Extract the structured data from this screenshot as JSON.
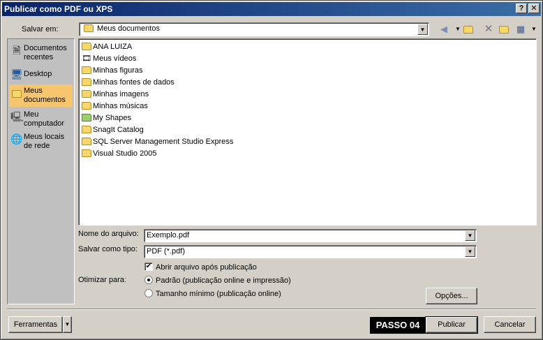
{
  "window": {
    "title": "Publicar como PDF ou XPS",
    "help_button": "?",
    "close_button": "✕"
  },
  "savein": {
    "label": "Salvar em:",
    "value": "Meus documentos"
  },
  "toolbar": {
    "icons": [
      "back-icon",
      "up-folder-icon",
      "delete-icon",
      "new-folder-icon",
      "views-icon"
    ]
  },
  "places": [
    {
      "label": "Documentos recentes",
      "icon": "recent-documents-icon"
    },
    {
      "label": "Desktop",
      "icon": "desktop-icon"
    },
    {
      "label": "Meus documentos",
      "icon": "my-documents-icon",
      "selected": true
    },
    {
      "label": "Meu computador",
      "icon": "my-computer-icon"
    },
    {
      "label": "Meus locais de rede",
      "icon": "network-places-icon"
    }
  ],
  "files": [
    {
      "name": "ANA LUIZA",
      "icon": "folder-icon"
    },
    {
      "name": "Meus vídeos",
      "icon": "videos-folder-icon"
    },
    {
      "name": "Minhas figuras",
      "icon": "pictures-folder-icon"
    },
    {
      "name": "Minhas fontes de dados",
      "icon": "data-sources-folder-icon"
    },
    {
      "name": "Minhas imagens",
      "icon": "images-folder-icon"
    },
    {
      "name": "Minhas músicas",
      "icon": "music-folder-icon"
    },
    {
      "name": "My Shapes",
      "icon": "shapes-folder-icon"
    },
    {
      "name": "SnagIt Catalog",
      "icon": "folder-icon"
    },
    {
      "name": "SQL Server Management Studio Express",
      "icon": "folder-icon"
    },
    {
      "name": "Visual Studio 2005",
      "icon": "folder-icon"
    }
  ],
  "filename": {
    "label": "Nome do arquivo:",
    "value": "Exemplo.pdf"
  },
  "savetype": {
    "label": "Salvar como tipo:",
    "value": "PDF (*.pdf)"
  },
  "open_after": {
    "label": "Abrir arquivo após publicação",
    "checked": true
  },
  "optimize": {
    "label": "Otimizar para:",
    "options": [
      {
        "label": "Padrão (publicação online e impressão)",
        "selected": true
      },
      {
        "label": "Tamanho mínimo (publicação online)",
        "selected": false
      }
    ]
  },
  "buttons": {
    "options": "Opções...",
    "tools": "Ferramentas",
    "publish": "Publicar",
    "cancel": "Cancelar"
  },
  "annotation": {
    "step": "PASSO 04"
  }
}
